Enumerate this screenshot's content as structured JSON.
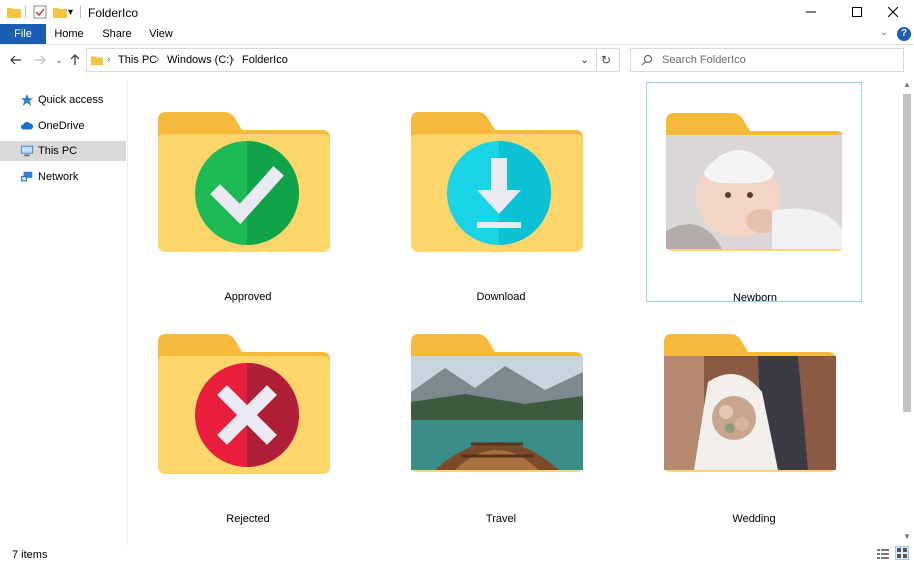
{
  "window": {
    "title": "FolderIco"
  },
  "ribbon": {
    "tabs": [
      {
        "label": "File"
      },
      {
        "label": "Home"
      },
      {
        "label": "Share"
      },
      {
        "label": "View"
      }
    ]
  },
  "address": {
    "crumbs": [
      "This PC",
      "Windows (C:)",
      "FolderIco"
    ]
  },
  "search": {
    "placeholder": "Search FolderIco"
  },
  "nav": {
    "items": [
      {
        "label": "Quick access",
        "icon": "star-icon"
      },
      {
        "label": "OneDrive",
        "icon": "cloud-icon"
      },
      {
        "label": "This PC",
        "icon": "computer-icon",
        "selected": true
      },
      {
        "label": "Network",
        "icon": "network-icon"
      }
    ]
  },
  "items": [
    {
      "label": "Approved",
      "kind": "approved"
    },
    {
      "label": "Download",
      "kind": "download"
    },
    {
      "label": "Newborn",
      "kind": "photo-newborn",
      "selected": true
    },
    {
      "label": "Rejected",
      "kind": "rejected"
    },
    {
      "label": "Travel",
      "kind": "photo-travel"
    },
    {
      "label": "Wedding",
      "kind": "photo-wedding"
    }
  ],
  "status": {
    "count": "7 items"
  },
  "colors": {
    "accent": "#1a5fb4",
    "folder_back": "#f6b93b",
    "folder_front": "#fcd56b",
    "approved": "#1db954",
    "download": "#19d3e6",
    "rejected": "#e81e3c",
    "selection_border": "#99d1ff"
  }
}
